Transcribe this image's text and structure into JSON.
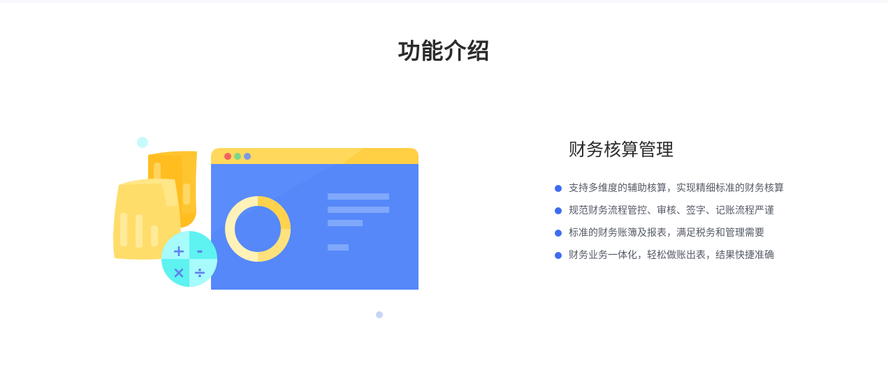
{
  "section": {
    "title": "功能介绍"
  },
  "feature": {
    "title": "财务核算管理",
    "bullet_color": "#3d6cf0",
    "items": [
      "支持多维度的辅助核算，实现精细标准的财务核算",
      "规范财务流程管控、审核、签字、记账流程严谨",
      "标准的财务账簿及报表，满足税务和管理需要",
      "财务业务一体化，轻松做账出表，结果快捷准确"
    ]
  },
  "illustration": {
    "icons": [
      "browser-window-icon",
      "donut-chart-icon",
      "coin-stack-icon",
      "calculator-icon"
    ],
    "calculator_symbols": [
      "+",
      "-",
      "×",
      "÷"
    ],
    "colors": {
      "window": "#5b8cfb",
      "window_bar": "#ffd85c",
      "coin": "#ffc72c",
      "calculator": "#5ef2f0"
    }
  }
}
